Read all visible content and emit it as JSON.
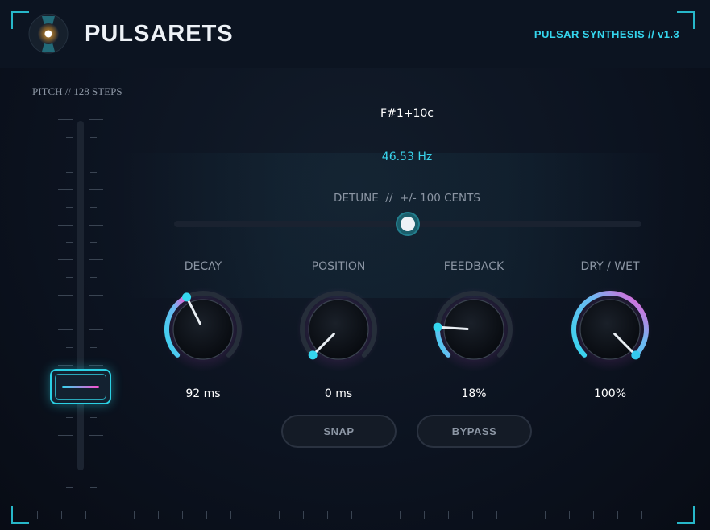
{
  "header": {
    "title": "PULSARETS",
    "version": "PULSAR SYNTHESIS // v1.3",
    "icon": "pulsar-logo-icon"
  },
  "pitch": {
    "label": "PITCH // 128 STEPS",
    "note": "F#1+10c",
    "frequency": "46.53 Hz",
    "slider_fraction": 0.24
  },
  "detune": {
    "label": "DETUNE  //  +/- 100 CENTS",
    "fraction": 0.5
  },
  "knobs": [
    {
      "id": "decay",
      "label": "DECAY",
      "value": "92 ms",
      "fraction": 0.4
    },
    {
      "id": "position",
      "label": "POSITION",
      "value": "0 ms",
      "fraction": 0.0
    },
    {
      "id": "feedback",
      "label": "FEEDBACK",
      "value": "18%",
      "fraction": 0.18
    },
    {
      "id": "drywet",
      "label": "DRY / WET",
      "value": "100%",
      "fraction": 1.0
    }
  ],
  "buttons": {
    "snap": "SNAP",
    "bypass": "BYPASS"
  },
  "colors": {
    "accent_cyan": "#35d6ee",
    "accent_magenta": "#ff4fd2",
    "background": "#0c1320",
    "label_gray": "#8b95a3"
  }
}
